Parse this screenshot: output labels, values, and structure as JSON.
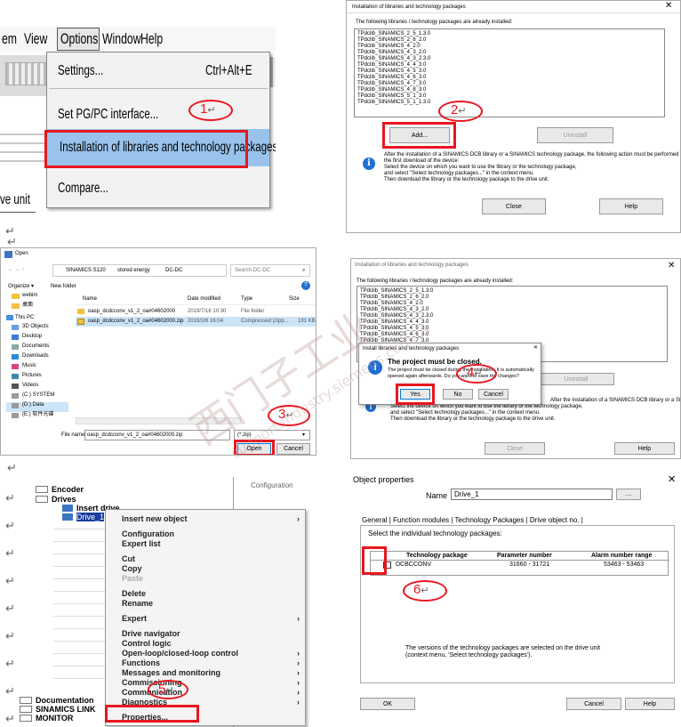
{
  "return_mark": "↵",
  "steps": [
    "1",
    "2",
    "3",
    "4",
    "5",
    "6"
  ],
  "colors": {
    "highlight_red": "#e8161f",
    "menu_selected": "#99c3ec",
    "folder_yellow": "#f0c040"
  },
  "panel1": {
    "menubar": [
      "em",
      "View",
      "Options",
      "Window",
      "Help"
    ],
    "menu_items": [
      "Settings...",
      "Set PG/PC interface...",
      "Installation of libraries and technology packages...",
      "Compare..."
    ],
    "shortcut": "Ctrl+Alt+E",
    "side_label": "ve unit"
  },
  "dialog_libs": {
    "title": "Installation of libraries and technology packages",
    "list_caption": "The following libraries / technology packages are already installed:",
    "packages": [
      "TPdclib_SINAMICS_2_5_1.3.0",
      "TPdclib_SINAMICS_2_6_2.0",
      "TPdclib_SINAMICS_4_2.0",
      "TPdclib_SINAMICS_4_3_2.0",
      "TPdclib_SINAMICS_4_3_2.3.0",
      "TPdclib_SINAMICS_4_4_3.0",
      "TPdclib_SINAMICS_4_5_3.0",
      "TPdclib_SINAMICS_4_6_3.0",
      "TPdclib_SINAMICS_4_7_3.0",
      "TPdclib_SINAMICS_4_8_3.0",
      "TPdclib_SINAMICS_5_1_3.0",
      "TPdclib_SINAMICS_5_1_1.3.0"
    ],
    "add": "Add...",
    "uninstall": "Uninstall",
    "info": [
      "After the installation of a SINAMICS DCB library or a SINAMICS technology package, the following action must be performed before",
      "the first download of the device:",
      "Select the device on which you want to use the library or the technology package,",
      "and select \"Select technology packages...\" in the context menu.",
      "Then download the library or the technology package to the drive unit."
    ],
    "close": "Close",
    "help": "Help"
  },
  "open_dialog": {
    "title": "Open",
    "path": [
      "SINAMICS S120",
      "stored energy",
      "DC-DC"
    ],
    "search": "Search DC-DC",
    "organize": "Organize ▾",
    "new_folder": "New folder",
    "columns": [
      "Name",
      "Date modified",
      "Type",
      "Size"
    ],
    "files": [
      {
        "name": "oasp_dcdcconv_v1_2_oa#04602000",
        "date": "2019/7/16 10:30",
        "type": "File folder",
        "size": ""
      },
      {
        "name": "oasp_dcdcconv_v1_2_oa#04602000.zip",
        "date": "2019/2/6 16:04",
        "type": "Compressed (zipp...",
        "size": "191 KB"
      }
    ],
    "sidebar": [
      "webim",
      "桌面",
      "This PC",
      "3D Objects",
      "Desktop",
      "Documents",
      "Downloads",
      "Music",
      "Pictures",
      "Videos",
      "(C:) SYSTEM",
      "(D:) Data",
      "(E:) 软件光碟"
    ],
    "file_name_label": "File name:",
    "file_name_value": "oasp_dcdcconv_v1_2_oa#04602000.zip",
    "filter": "(*.zip)",
    "open": "Open",
    "cancel": "Cancel"
  },
  "confirm": {
    "title": "Install libraries and technology packages",
    "heading": "The project must be closed.",
    "body": "The project must be closed during the installation. It is automatically opened again afterwards. Do you want to save the changes?",
    "yes": "Yes",
    "no": "No",
    "cancel": "Cancel"
  },
  "tree": {
    "items": [
      "Encoder",
      "Drives",
      "Insert drive",
      "Drive_1"
    ],
    "bottom": [
      "Documentation",
      "SINAMICS LINK",
      "MONITOR"
    ],
    "right_header": "Configuration"
  },
  "context_menu": [
    "Insert new object",
    "Configuration",
    "Expert list",
    "Cut",
    "Copy",
    "Paste",
    "Delete",
    "Rename",
    "Expert",
    "Drive navigator",
    "Control logic",
    "Open-loop/closed-loop control",
    "Functions",
    "Messages and monitoring",
    "Commissioning",
    "Communication",
    "Diagnostics",
    "Properties..."
  ],
  "obj_props": {
    "title": "Object properties",
    "name_label": "Name",
    "name_value": "Drive_1",
    "tabs": [
      "General",
      "Function modules",
      "Technology Packages",
      "Drive object no."
    ],
    "instruction": "Select the individual technology packages:",
    "columns": [
      "Technology package",
      "Parameter number",
      "Alarm number range"
    ],
    "row": {
      "package": "DCBCCONV",
      "params": "31660 - 31721",
      "alarms": "53463 - 53463"
    },
    "note": "The versions of the technology packages are selected on the drive unit (context menu, 'Select technology packages').",
    "ok": "OK",
    "cancel": "Cancel",
    "help": "Help"
  },
  "watermark": [
    "西门子工业",
    "support.industry.siemens.com/cs"
  ]
}
